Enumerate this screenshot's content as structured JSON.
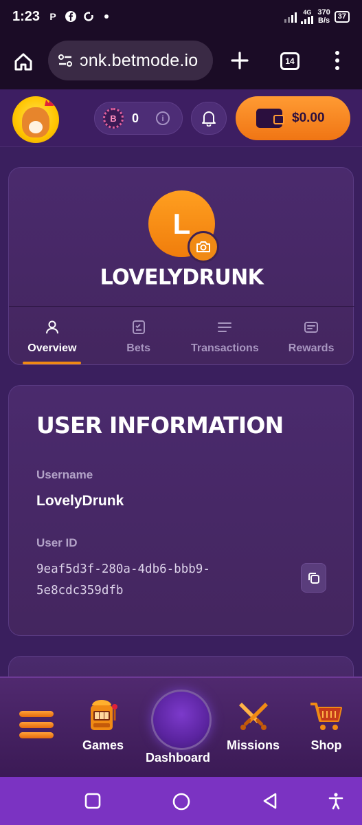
{
  "status_bar": {
    "time": "1:23",
    "network": "4G",
    "speed_value": "370",
    "speed_unit": "B/s",
    "battery": "37"
  },
  "browser": {
    "url": "ɔnk.betmode.io",
    "tab_count": "14"
  },
  "header": {
    "points": "0",
    "coin_letter": "B",
    "wallet_balance": "$0.00"
  },
  "profile": {
    "avatar_initial": "L",
    "display_name": "LOVELYDRUNK",
    "tabs": [
      {
        "label": "Overview",
        "active": true
      },
      {
        "label": "Bets",
        "active": false
      },
      {
        "label": "Transactions",
        "active": false
      },
      {
        "label": "Rewards",
        "active": false
      }
    ]
  },
  "user_info": {
    "title": "USER INFORMATION",
    "username_label": "Username",
    "username_value": "LovelyDrunk",
    "userid_label": "User ID",
    "userid_line1": "9eaf5d3f-280a-4db6-bbb9-",
    "userid_line2": "5e8cdc359dfb"
  },
  "bottom_nav": {
    "items": [
      {
        "label": "Games"
      },
      {
        "label": "Dashboard"
      },
      {
        "label": "Missions"
      },
      {
        "label": "Shop"
      }
    ]
  },
  "colors": {
    "accent": "#f08a14",
    "background": "#3a1f5e",
    "android_nav": "#7b33c2"
  }
}
